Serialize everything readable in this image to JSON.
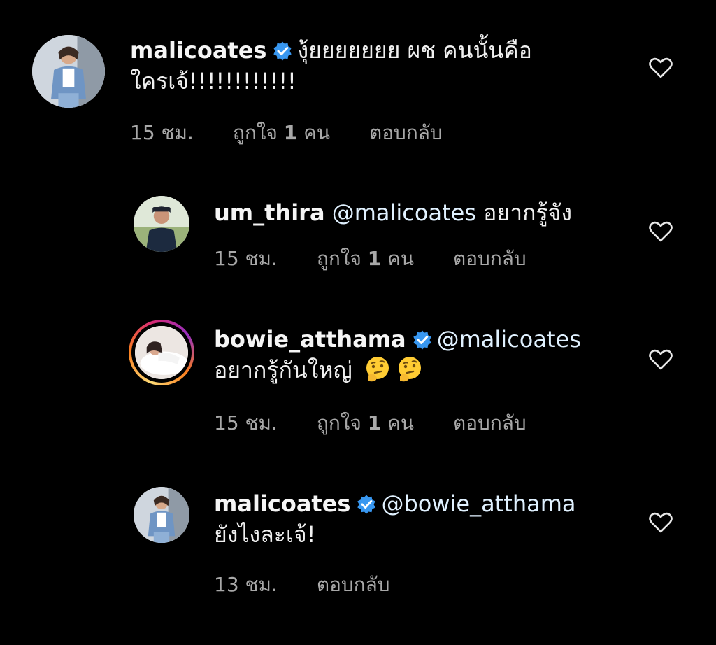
{
  "comments": [
    {
      "username": "malicoates",
      "verified": true,
      "text_line1": "งุ้ยยยยยยย ผช คนนั้นคือ",
      "text_line2": "ใครเจ้!!!!!!!!!!!!",
      "time": "15 ชม.",
      "likes_prefix": "ถูกใจ",
      "likes_count": "1",
      "likes_suffix": "คน",
      "reply": "ตอบกลับ"
    },
    {
      "username": "um_thira",
      "verified": false,
      "mention": "@malicoates",
      "text": "อยากรู้จัง",
      "time": "15 ชม.",
      "likes_prefix": "ถูกใจ",
      "likes_count": "1",
      "likes_suffix": "คน",
      "reply": "ตอบกลับ"
    },
    {
      "username": "bowie_atthama",
      "verified": true,
      "mention": "@malicoates",
      "text": "อยากรู้กันใหญ่",
      "emoji": [
        "thinking-face",
        "thinking-face"
      ],
      "time": "15 ชม.",
      "likes_prefix": "ถูกใจ",
      "likes_count": "1",
      "likes_suffix": "คน",
      "reply": "ตอบกลับ"
    },
    {
      "username": "malicoates",
      "verified": true,
      "mention": "@bowie_atthama",
      "text": "ยังไงละเจ้!",
      "time": "13 ชม.",
      "reply": "ตอบกลับ"
    }
  ],
  "colors": {
    "background": "#000000",
    "verified_badge": "#3897f0",
    "meta_text": "#a8a8a8",
    "mention_text": "#e0f1ff"
  }
}
